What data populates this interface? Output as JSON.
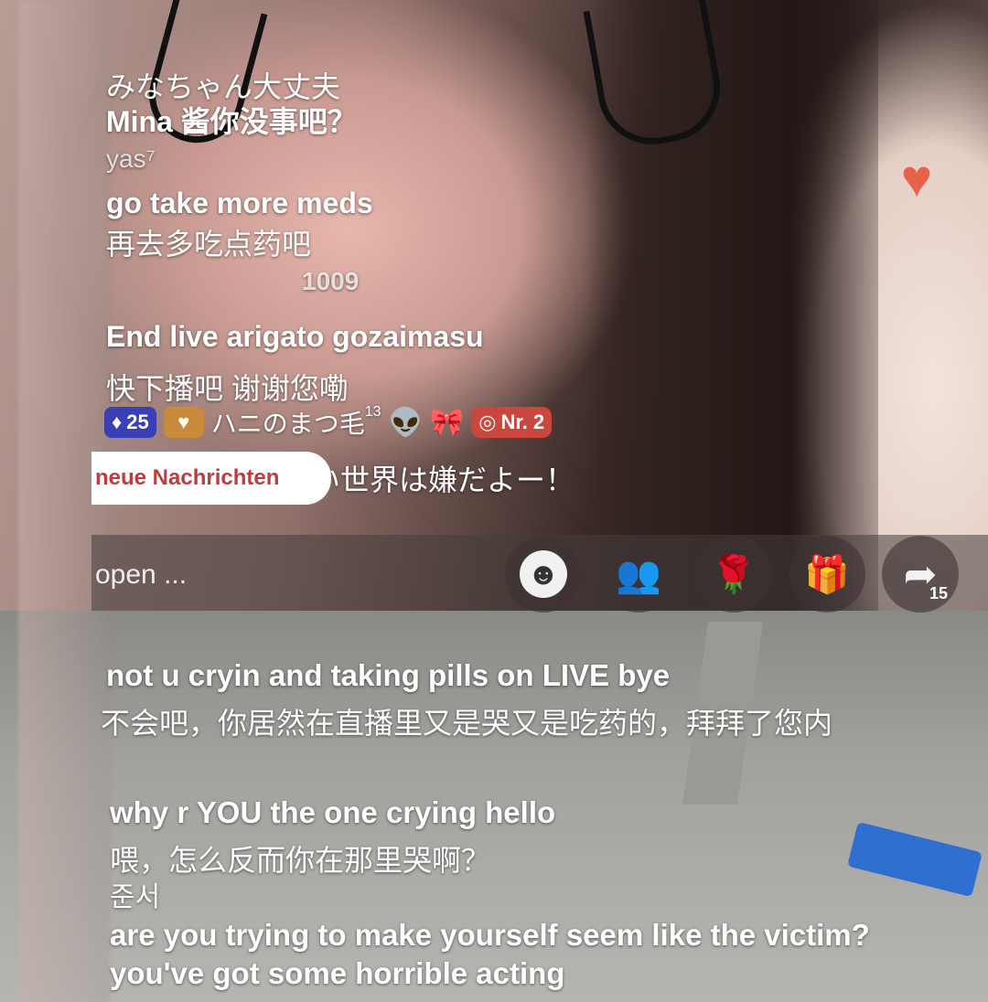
{
  "chat_top": [
    {
      "id": "jp-line",
      "text": "みなちゃん大丈夫"
    },
    {
      "id": "mina-line",
      "text": "Mina 酱你没事吧？"
    },
    {
      "id": "user-yas",
      "text": "yas⁷"
    },
    {
      "id": "meds-en",
      "text": "go take more meds"
    },
    {
      "id": "meds-zh",
      "text": "再去多吃点药吧"
    },
    {
      "id": "user-1009",
      "text": "1009"
    },
    {
      "id": "endlive-en",
      "text": "End live arigato gozaimasu"
    },
    {
      "id": "endlive-zh",
      "text": "快下播吧 谢谢您嘞"
    }
  ],
  "badges": {
    "gem_count": "25",
    "username": "ハニのまつ毛",
    "username_sup": "13",
    "rank": "Nr. 2"
  },
  "partial_message": "い世界は嫌だよー！",
  "new_messages_label": "neue Nachrichten",
  "comment_placeholder": "open ...",
  "share_count": "15",
  "chat_bottom": [
    {
      "id": "cryin-en",
      "text": "not u cryin and taking pills on LIVE bye"
    },
    {
      "id": "cryin-zh",
      "text": "不会吧，你居然在直播里又是哭又是吃药的，拜拜了您内"
    },
    {
      "id": "crying-en",
      "text": "why r YOU the one crying hello"
    },
    {
      "id": "crying-zh",
      "text": "喂，怎么反而你在那里哭啊？"
    },
    {
      "id": "user-korean",
      "text": "준서"
    },
    {
      "id": "victim-en",
      "text": "are you trying to make yourself seem like the victim?"
    },
    {
      "id": "acting-en",
      "text": "you've got some horrible acting"
    }
  ],
  "colors": {
    "heart": "#e8614a",
    "gem_badge": "#3b3fb5",
    "rank_badge": "#c9473c",
    "new_messages_text": "#c03a3f"
  },
  "icons": [
    "heart-icon",
    "gem-icon",
    "heart-badge-icon",
    "alien-emoji",
    "bow-emoji",
    "rank-icon",
    "emoji-face-icon",
    "people-icon",
    "rose-icon",
    "gift-icon",
    "share-arrow-icon"
  ]
}
